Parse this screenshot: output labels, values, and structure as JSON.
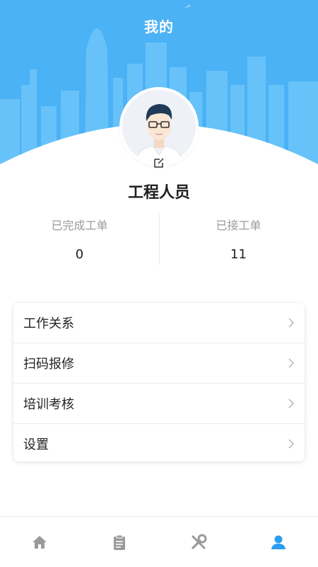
{
  "header": {
    "title": "我的"
  },
  "profile": {
    "name": "工程人员",
    "stats": [
      {
        "label": "已完成工单",
        "value": "0"
      },
      {
        "label": "已接工单",
        "value": "11"
      }
    ]
  },
  "menu": {
    "items": [
      {
        "label": "工作关系"
      },
      {
        "label": "扫码报修"
      },
      {
        "label": "培训考核"
      },
      {
        "label": "设置"
      }
    ]
  },
  "bottom_nav": {
    "tabs": [
      {
        "icon": "home-icon",
        "active": false
      },
      {
        "icon": "clipboard-icon",
        "active": false
      },
      {
        "icon": "tools-icon",
        "active": false
      },
      {
        "icon": "user-icon",
        "active": true
      }
    ]
  },
  "colors": {
    "header_blue": "#4ab2f5",
    "skyline": "#6cc4fb",
    "tab_inactive": "#9a9a9a",
    "tab_active": "#2a9ef0"
  }
}
